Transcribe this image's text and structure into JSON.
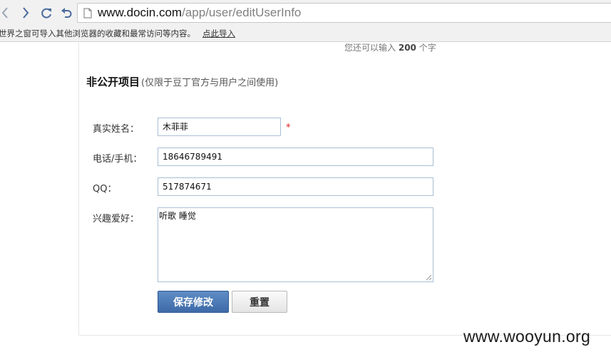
{
  "browser": {
    "url_host": "www.docin.com",
    "url_path": "/app/user/editUserInfo",
    "bookmark_message": "世界之窗可导入其他浏览器的收藏和最常访问等内容。",
    "bookmark_link": "点此导入"
  },
  "form": {
    "counter_prefix": "您还可以输入",
    "counter_value": "200",
    "counter_suffix": "个字",
    "section_title": "非公开项目",
    "section_note": "(仅限于豆丁官方与用户之间使用)",
    "fields": {
      "real_name": {
        "label": "真实姓名：",
        "value": "木菲菲",
        "required_mark": "*"
      },
      "phone": {
        "label": "电话/手机：",
        "value": "18646789491"
      },
      "qq": {
        "label": "QQ：",
        "value": "517874671"
      },
      "hobbies": {
        "label": "兴趣爱好：",
        "value": "听歌 睡觉"
      }
    },
    "save_label": "保存修改",
    "reset_label": "重置"
  },
  "watermark": "www.wooyun.org"
}
